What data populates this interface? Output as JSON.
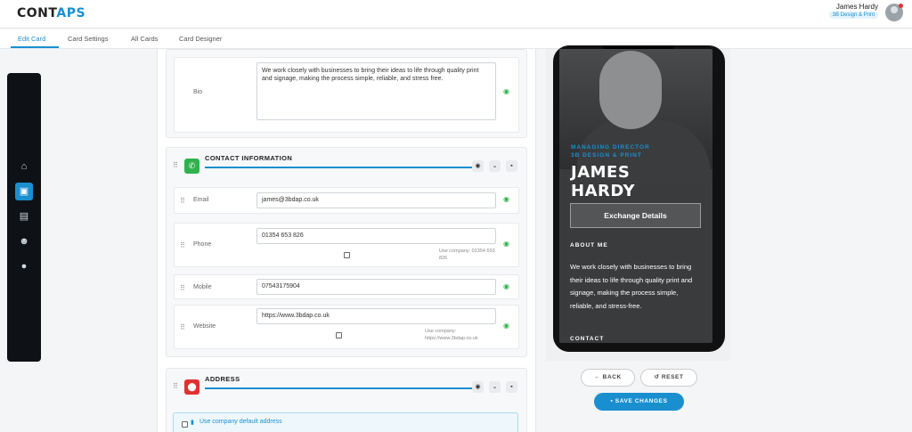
{
  "header": {
    "logo_main": "CONT",
    "logo_accent": "APS",
    "user_name": "James Hardy",
    "user_company": "3B Design & Print"
  },
  "tabs": [
    {
      "label": "Edit Card",
      "active": true
    },
    {
      "label": "Card Settings",
      "active": false
    },
    {
      "label": "All Cards",
      "active": false
    },
    {
      "label": "Card Designer",
      "active": false
    }
  ],
  "sidebar": {
    "icons": [
      "home-icon",
      "card-icon",
      "contact-book-icon",
      "users-icon",
      "user-circle-icon"
    ],
    "active_index": 1
  },
  "bio": {
    "label": "Bio",
    "value": "We work closely with businesses to bring their ideas to life through quality print and signage, making the process simple, reliable, and stress free."
  },
  "contact_section": {
    "title": "CONTACT INFORMATION",
    "icon_color": "#2fb24c",
    "fields": {
      "email": {
        "label": "Email",
        "value": "james@3bdap.co.uk"
      },
      "phone": {
        "label": "Phone",
        "value": "01354 653 826",
        "hint": "Use company: 01354 653 826"
      },
      "mobile": {
        "label": "Mobile",
        "value": "07543175904"
      },
      "website": {
        "label": "Website",
        "value": "https://www.3bdap.co.uk",
        "hint": "Use company: https://www.3bdap.co.uk"
      }
    }
  },
  "address_section": {
    "title": "ADDRESS",
    "icon_color": "#e03131",
    "default_address_label": "Use company default address"
  },
  "preview": {
    "role_line1": "MANAGING DIRECTOR",
    "role_line2": "3B DESIGN & PRINT",
    "name_line1": "JAMES",
    "name_line2": "HARDY",
    "exchange_button": "Exchange Details",
    "about_heading": "ABOUT ME",
    "about_text": "We work closely with businesses to bring their ideas to life through quality print and signage, making the process simple, reliable, and stress-free.",
    "contact_heading": "CONTACT"
  },
  "actions": {
    "back": "BACK",
    "reset": "RESET",
    "save": "SAVE CHANGES"
  },
  "colors": {
    "accent": "#1a8fd0",
    "visible_eye": "#2fb24c",
    "sidebar_bg": "#0e1217"
  }
}
